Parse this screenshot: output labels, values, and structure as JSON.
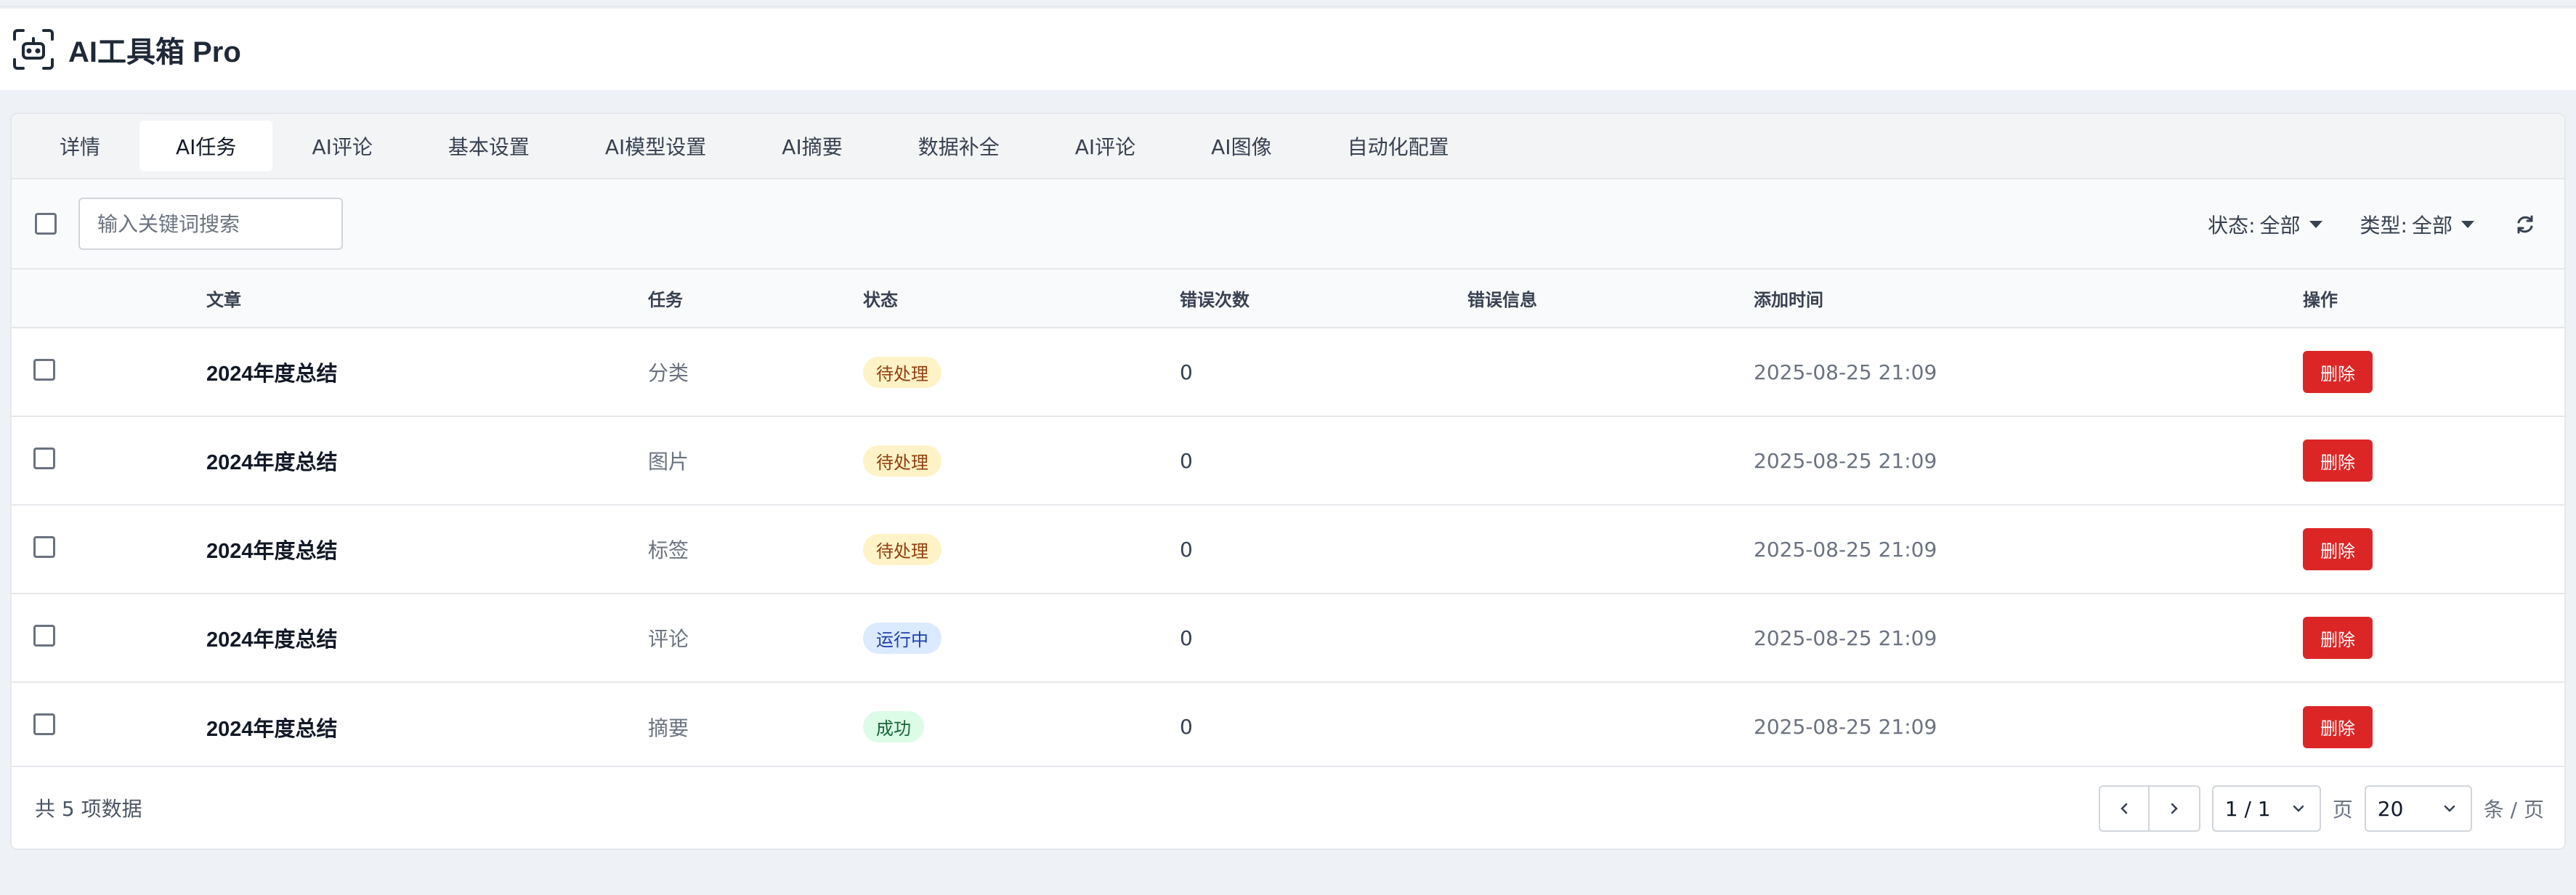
{
  "app": {
    "title": "AI工具箱 Pro"
  },
  "tabs": [
    {
      "label": "详情",
      "active": false
    },
    {
      "label": "AI任务",
      "active": true
    },
    {
      "label": "AI评论",
      "active": false
    },
    {
      "label": "基本设置",
      "active": false
    },
    {
      "label": "AI模型设置",
      "active": false
    },
    {
      "label": "AI摘要",
      "active": false
    },
    {
      "label": "数据补全",
      "active": false
    },
    {
      "label": "AI评论",
      "active": false
    },
    {
      "label": "AI图像",
      "active": false
    },
    {
      "label": "自动化配置",
      "active": false
    }
  ],
  "toolbar": {
    "search_placeholder": "输入关键词搜索",
    "status_label": "状态:",
    "status_value": "全部",
    "type_label": "类型:",
    "type_value": "全部"
  },
  "table": {
    "headers": {
      "article": "文章",
      "task": "任务",
      "status": "状态",
      "errors": "错误次数",
      "error_info": "错误信息",
      "added": "添加时间",
      "actions": "操作"
    },
    "rows": [
      {
        "article": "2024年度总结",
        "task": "分类",
        "status": "待处理",
        "errors": "0",
        "error_info": "",
        "added": "2025-08-25 21:09",
        "action": "删除"
      },
      {
        "article": "2024年度总结",
        "task": "图片",
        "status": "待处理",
        "errors": "0",
        "error_info": "",
        "added": "2025-08-25 21:09",
        "action": "删除"
      },
      {
        "article": "2024年度总结",
        "task": "标签",
        "status": "待处理",
        "errors": "0",
        "error_info": "",
        "added": "2025-08-25 21:09",
        "action": "删除"
      },
      {
        "article": "2024年度总结",
        "task": "评论",
        "status": "运行中",
        "errors": "0",
        "error_info": "",
        "added": "2025-08-25 21:09",
        "action": "删除"
      },
      {
        "article": "2024年度总结",
        "task": "摘要",
        "status": "成功",
        "errors": "0",
        "error_info": "",
        "added": "2025-08-25 21:09",
        "action": "删除"
      }
    ]
  },
  "footer": {
    "total": "共 5 项数据",
    "page_value": "1 / 1",
    "page_suffix": "页",
    "page_size": "20",
    "page_size_suffix": "条 / 页"
  },
  "colors": {
    "danger": "#dc2626",
    "pending_bg": "#fef3c7",
    "running_bg": "#dbeafe",
    "success_bg": "#dcfce7"
  }
}
